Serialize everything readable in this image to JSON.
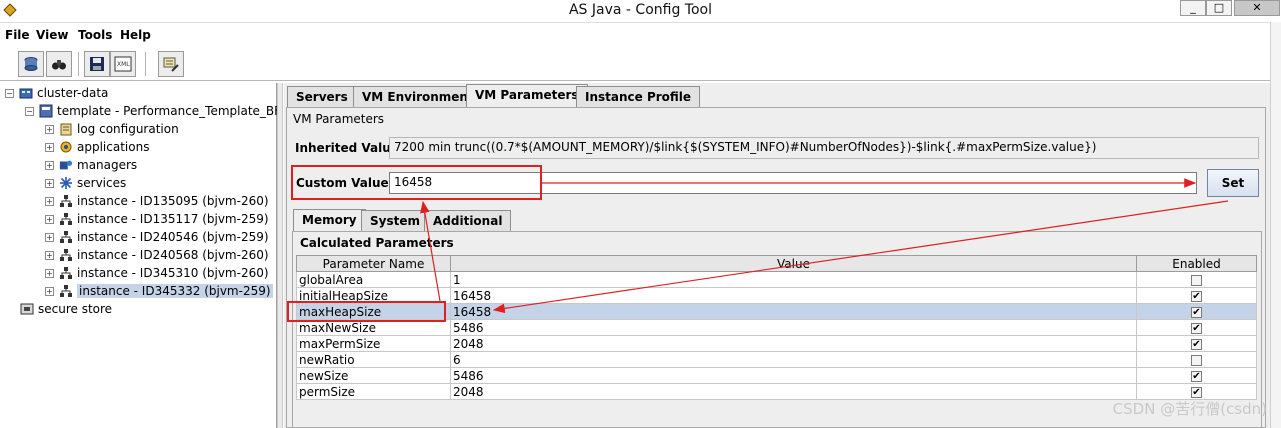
{
  "window": {
    "title": "AS Java - Config Tool",
    "controls": [
      "_",
      "□",
      "✕"
    ]
  },
  "menu": [
    "File",
    "View",
    "Tools",
    "Help"
  ],
  "toolbar": {
    "icons": [
      "database-icon",
      "binoculars-icon",
      "save-icon",
      "xml-icon",
      "wizard-icon"
    ],
    "xml_text": "XML"
  },
  "tree": {
    "root": "cluster-data",
    "template": "template - Performance_Template_BF",
    "children": [
      "log configuration",
      "applications",
      "managers",
      "services"
    ],
    "instances": [
      "instance - ID135095 (bjvm-260)",
      "instance - ID135117 (bjvm-259)",
      "instance - ID240546 (bjvm-259)",
      "instance - ID240568 (bjvm-260)",
      "instance - ID345310 (bjvm-260)",
      "instance - ID345332 (bjvm-259)"
    ],
    "selected_instance_index": 5,
    "secure_store": "secure store"
  },
  "tabs": [
    "Servers",
    "VM Environment",
    "VM Parameters",
    "Instance Profile"
  ],
  "active_tab": "VM Parameters",
  "vm": {
    "section_title": "VM Parameters",
    "inherited_label": "Inherited Value",
    "inherited_value": "7200 min trunc((0.7*$(AMOUNT_MEMORY)/$link{$(SYSTEM_INFO)#NumberOfNodes})-$link{.#maxPermSize.value})",
    "custom_label": "Custom Value",
    "custom_value": "16458",
    "set_button": "Set"
  },
  "subtabs": [
    "Memory",
    "System",
    "Additional"
  ],
  "active_subtab": "Memory",
  "calc": {
    "title": "Calculated Parameters",
    "columns": [
      "Parameter Name",
      "Value",
      "Enabled"
    ],
    "rows": [
      {
        "name": "globalArea",
        "value": "1",
        "enabled": false
      },
      {
        "name": "initialHeapSize",
        "value": "16458",
        "enabled": true
      },
      {
        "name": "maxHeapSize",
        "value": "16458",
        "enabled": true,
        "selected": true
      },
      {
        "name": "maxNewSize",
        "value": "5486",
        "enabled": true
      },
      {
        "name": "maxPermSize",
        "value": "2048",
        "enabled": true
      },
      {
        "name": "newRatio",
        "value": "6",
        "enabled": false
      },
      {
        "name": "newSize",
        "value": "5486",
        "enabled": true
      },
      {
        "name": "permSize",
        "value": "2048",
        "enabled": true
      }
    ]
  },
  "annotation_color": "#e02020",
  "watermark": "CSDN @苦行僧(csdn)"
}
